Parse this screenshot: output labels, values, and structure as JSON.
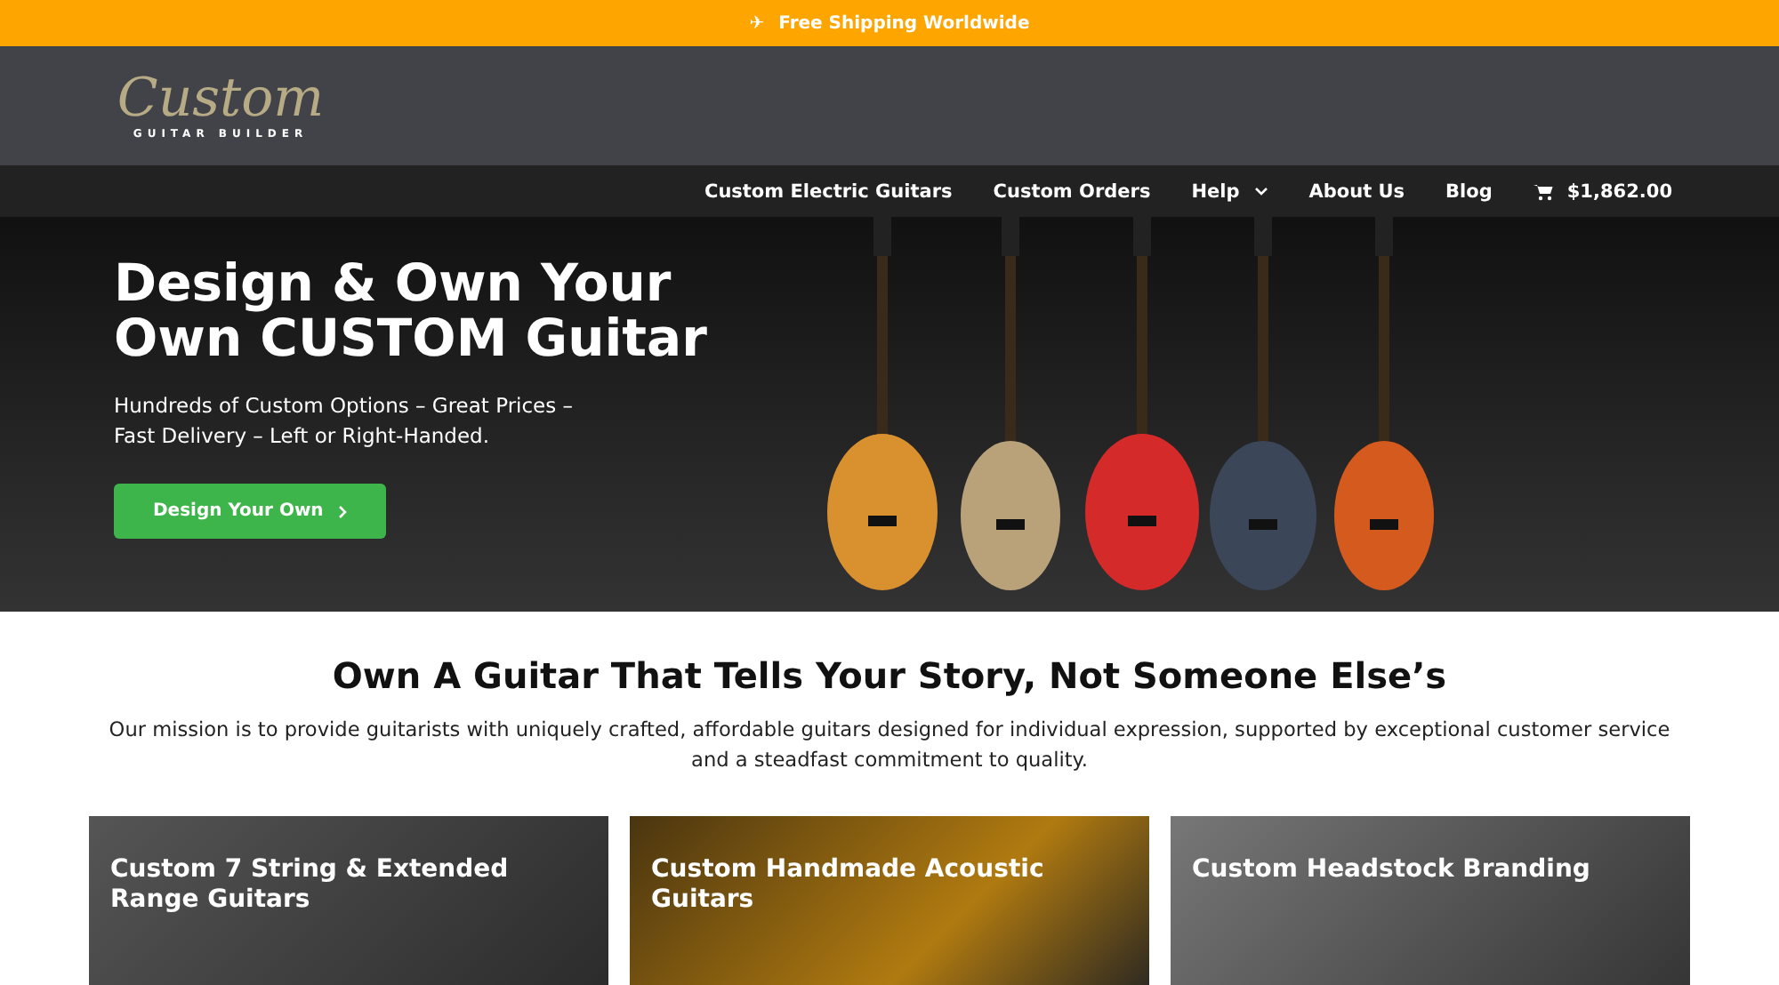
{
  "topbar": {
    "icon": "✈",
    "text": "Free Shipping Worldwide"
  },
  "logo": {
    "script": "Custom",
    "tagline": "GUITAR BUILDER"
  },
  "nav": {
    "items": [
      {
        "label": "Custom Electric Guitars",
        "dropdown": false
      },
      {
        "label": "Custom Orders",
        "dropdown": false
      },
      {
        "label": "Help",
        "dropdown": true
      },
      {
        "label": "About Us",
        "dropdown": false
      },
      {
        "label": "Blog",
        "dropdown": false
      }
    ],
    "cart": "$1,862.00"
  },
  "hero": {
    "title": "Design & Own Your Own CUSTOM Guitar",
    "subtitle": "Hundreds of Custom Options – Great Prices – Fast Delivery – Left or Right-Handed.",
    "button": "Design Your Own"
  },
  "mission": {
    "heading": "Own A Guitar That Tells Your Story, Not Someone Else’s",
    "text": "Our mission is to provide guitarists with uniquely crafted, affordable guitars designed for individual expression, supported by exceptional customer service and a steadfast commitment to quality."
  },
  "cards": [
    {
      "title": "Custom 7 String & Extended Range Guitars"
    },
    {
      "title": "Custom Handmade Acoustic Guitars"
    },
    {
      "title": "Custom Headstock Branding"
    }
  ]
}
